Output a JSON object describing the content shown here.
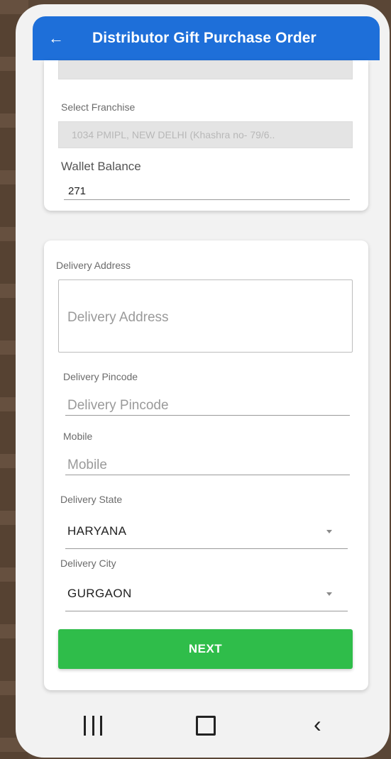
{
  "appbar": {
    "title": "Distributor Gift Purchase Order",
    "back_icon": "arrow-left-icon"
  },
  "franchise": {
    "label": "Select Franchise",
    "value": "1034 PMIPL, NEW DELHI (Khashra no- 79/6.."
  },
  "wallet": {
    "label": "Wallet Balance",
    "value": "271"
  },
  "delivery": {
    "address_label": "Delivery Address",
    "address_placeholder": "Delivery Address",
    "pincode_label": "Delivery Pincode",
    "pincode_placeholder": "Delivery Pincode",
    "mobile_label": "Mobile",
    "mobile_placeholder": "Mobile",
    "state_label": "Delivery State",
    "state_value": "HARYANA",
    "city_label": "Delivery City",
    "city_value": "GURGAON"
  },
  "next_button": {
    "label": "NEXT"
  },
  "colors": {
    "primary": "#1e6fd9",
    "button": "#2fbd4a"
  }
}
